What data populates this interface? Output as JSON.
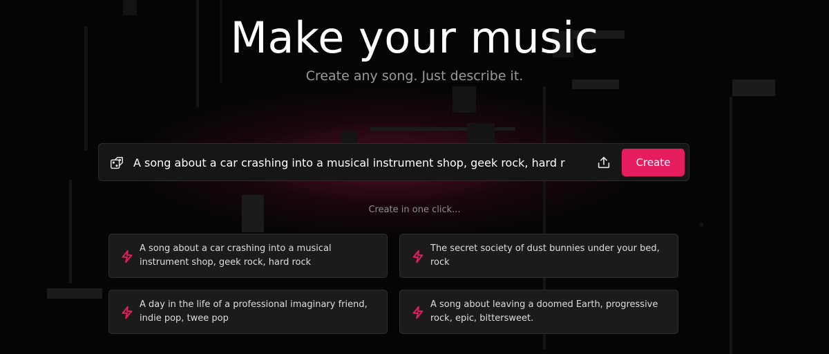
{
  "hero": {
    "title": "Make your music",
    "subtitle": "Create any song. Just describe it."
  },
  "prompt": {
    "value": "A song about a car crashing into a musical instrument shop, geek rock, hard r",
    "dice_icon": "dice-icon",
    "upload_icon": "upload-icon",
    "create_label": "Create"
  },
  "quick": {
    "heading": "Create in one click...",
    "icon": "lightning-bolt-icon",
    "items": [
      "A song about a car crashing into a musical instrument shop, geek rock, hard rock",
      "The secret society of dust bunnies under your bed, rock",
      "A day in the life of a professional imaginary friend, indie pop, twee pop",
      "A song about leaving a doomed Earth, progressive rock, epic, bittersweet."
    ]
  },
  "colors": {
    "accent": "#e51d5e",
    "background": "#050505",
    "card": "#1b1b1b"
  }
}
